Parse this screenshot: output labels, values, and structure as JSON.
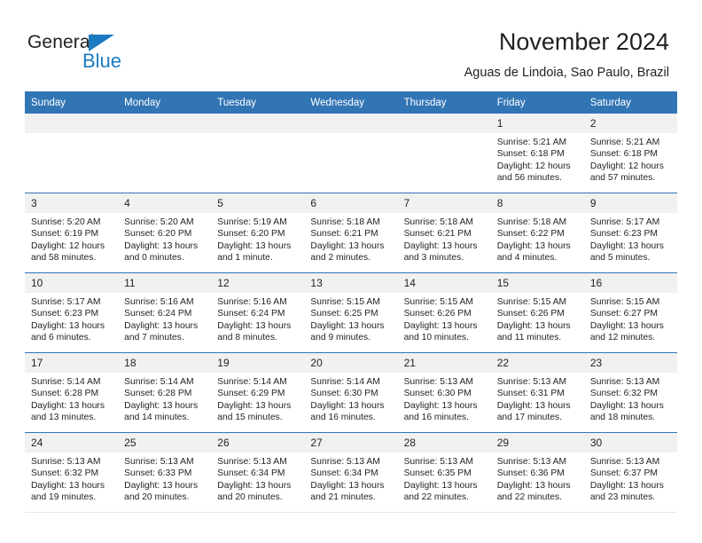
{
  "brand": {
    "name_part1": "General",
    "name_part2": "Blue",
    "triangle_icon": "triangle-icon",
    "accent_color": "#1b7bc0"
  },
  "header": {
    "title": "November 2024",
    "subtitle": "Aguas de Lindoia, Sao Paulo, Brazil",
    "header_bg_color": "#3275b5",
    "daynum_bg_color": "#f1f1f1"
  },
  "weekday_headers": [
    "Sunday",
    "Monday",
    "Tuesday",
    "Wednesday",
    "Thursday",
    "Friday",
    "Saturday"
  ],
  "weeks": [
    {
      "days": [
        {
          "num": "",
          "empty": true,
          "sunrise": "",
          "sunset": "",
          "daylight": ""
        },
        {
          "num": "",
          "empty": true,
          "sunrise": "",
          "sunset": "",
          "daylight": ""
        },
        {
          "num": "",
          "empty": true,
          "sunrise": "",
          "sunset": "",
          "daylight": ""
        },
        {
          "num": "",
          "empty": true,
          "sunrise": "",
          "sunset": "",
          "daylight": ""
        },
        {
          "num": "",
          "empty": true,
          "sunrise": "",
          "sunset": "",
          "daylight": ""
        },
        {
          "num": "1",
          "empty": false,
          "sunrise": "Sunrise: 5:21 AM",
          "sunset": "Sunset: 6:18 PM",
          "daylight": "Daylight: 12 hours and 56 minutes."
        },
        {
          "num": "2",
          "empty": false,
          "sunrise": "Sunrise: 5:21 AM",
          "sunset": "Sunset: 6:18 PM",
          "daylight": "Daylight: 12 hours and 57 minutes."
        }
      ]
    },
    {
      "days": [
        {
          "num": "3",
          "empty": false,
          "sunrise": "Sunrise: 5:20 AM",
          "sunset": "Sunset: 6:19 PM",
          "daylight": "Daylight: 12 hours and 58 minutes."
        },
        {
          "num": "4",
          "empty": false,
          "sunrise": "Sunrise: 5:20 AM",
          "sunset": "Sunset: 6:20 PM",
          "daylight": "Daylight: 13 hours and 0 minutes."
        },
        {
          "num": "5",
          "empty": false,
          "sunrise": "Sunrise: 5:19 AM",
          "sunset": "Sunset: 6:20 PM",
          "daylight": "Daylight: 13 hours and 1 minute."
        },
        {
          "num": "6",
          "empty": false,
          "sunrise": "Sunrise: 5:18 AM",
          "sunset": "Sunset: 6:21 PM",
          "daylight": "Daylight: 13 hours and 2 minutes."
        },
        {
          "num": "7",
          "empty": false,
          "sunrise": "Sunrise: 5:18 AM",
          "sunset": "Sunset: 6:21 PM",
          "daylight": "Daylight: 13 hours and 3 minutes."
        },
        {
          "num": "8",
          "empty": false,
          "sunrise": "Sunrise: 5:18 AM",
          "sunset": "Sunset: 6:22 PM",
          "daylight": "Daylight: 13 hours and 4 minutes."
        },
        {
          "num": "9",
          "empty": false,
          "sunrise": "Sunrise: 5:17 AM",
          "sunset": "Sunset: 6:23 PM",
          "daylight": "Daylight: 13 hours and 5 minutes."
        }
      ]
    },
    {
      "days": [
        {
          "num": "10",
          "empty": false,
          "sunrise": "Sunrise: 5:17 AM",
          "sunset": "Sunset: 6:23 PM",
          "daylight": "Daylight: 13 hours and 6 minutes."
        },
        {
          "num": "11",
          "empty": false,
          "sunrise": "Sunrise: 5:16 AM",
          "sunset": "Sunset: 6:24 PM",
          "daylight": "Daylight: 13 hours and 7 minutes."
        },
        {
          "num": "12",
          "empty": false,
          "sunrise": "Sunrise: 5:16 AM",
          "sunset": "Sunset: 6:24 PM",
          "daylight": "Daylight: 13 hours and 8 minutes."
        },
        {
          "num": "13",
          "empty": false,
          "sunrise": "Sunrise: 5:15 AM",
          "sunset": "Sunset: 6:25 PM",
          "daylight": "Daylight: 13 hours and 9 minutes."
        },
        {
          "num": "14",
          "empty": false,
          "sunrise": "Sunrise: 5:15 AM",
          "sunset": "Sunset: 6:26 PM",
          "daylight": "Daylight: 13 hours and 10 minutes."
        },
        {
          "num": "15",
          "empty": false,
          "sunrise": "Sunrise: 5:15 AM",
          "sunset": "Sunset: 6:26 PM",
          "daylight": "Daylight: 13 hours and 11 minutes."
        },
        {
          "num": "16",
          "empty": false,
          "sunrise": "Sunrise: 5:15 AM",
          "sunset": "Sunset: 6:27 PM",
          "daylight": "Daylight: 13 hours and 12 minutes."
        }
      ]
    },
    {
      "days": [
        {
          "num": "17",
          "empty": false,
          "sunrise": "Sunrise: 5:14 AM",
          "sunset": "Sunset: 6:28 PM",
          "daylight": "Daylight: 13 hours and 13 minutes."
        },
        {
          "num": "18",
          "empty": false,
          "sunrise": "Sunrise: 5:14 AM",
          "sunset": "Sunset: 6:28 PM",
          "daylight": "Daylight: 13 hours and 14 minutes."
        },
        {
          "num": "19",
          "empty": false,
          "sunrise": "Sunrise: 5:14 AM",
          "sunset": "Sunset: 6:29 PM",
          "daylight": "Daylight: 13 hours and 15 minutes."
        },
        {
          "num": "20",
          "empty": false,
          "sunrise": "Sunrise: 5:14 AM",
          "sunset": "Sunset: 6:30 PM",
          "daylight": "Daylight: 13 hours and 16 minutes."
        },
        {
          "num": "21",
          "empty": false,
          "sunrise": "Sunrise: 5:13 AM",
          "sunset": "Sunset: 6:30 PM",
          "daylight": "Daylight: 13 hours and 16 minutes."
        },
        {
          "num": "22",
          "empty": false,
          "sunrise": "Sunrise: 5:13 AM",
          "sunset": "Sunset: 6:31 PM",
          "daylight": "Daylight: 13 hours and 17 minutes."
        },
        {
          "num": "23",
          "empty": false,
          "sunrise": "Sunrise: 5:13 AM",
          "sunset": "Sunset: 6:32 PM",
          "daylight": "Daylight: 13 hours and 18 minutes."
        }
      ]
    },
    {
      "days": [
        {
          "num": "24",
          "empty": false,
          "sunrise": "Sunrise: 5:13 AM",
          "sunset": "Sunset: 6:32 PM",
          "daylight": "Daylight: 13 hours and 19 minutes."
        },
        {
          "num": "25",
          "empty": false,
          "sunrise": "Sunrise: 5:13 AM",
          "sunset": "Sunset: 6:33 PM",
          "daylight": "Daylight: 13 hours and 20 minutes."
        },
        {
          "num": "26",
          "empty": false,
          "sunrise": "Sunrise: 5:13 AM",
          "sunset": "Sunset: 6:34 PM",
          "daylight": "Daylight: 13 hours and 20 minutes."
        },
        {
          "num": "27",
          "empty": false,
          "sunrise": "Sunrise: 5:13 AM",
          "sunset": "Sunset: 6:34 PM",
          "daylight": "Daylight: 13 hours and 21 minutes."
        },
        {
          "num": "28",
          "empty": false,
          "sunrise": "Sunrise: 5:13 AM",
          "sunset": "Sunset: 6:35 PM",
          "daylight": "Daylight: 13 hours and 22 minutes."
        },
        {
          "num": "29",
          "empty": false,
          "sunrise": "Sunrise: 5:13 AM",
          "sunset": "Sunset: 6:36 PM",
          "daylight": "Daylight: 13 hours and 22 minutes."
        },
        {
          "num": "30",
          "empty": false,
          "sunrise": "Sunrise: 5:13 AM",
          "sunset": "Sunset: 6:37 PM",
          "daylight": "Daylight: 13 hours and 23 minutes."
        }
      ]
    }
  ]
}
